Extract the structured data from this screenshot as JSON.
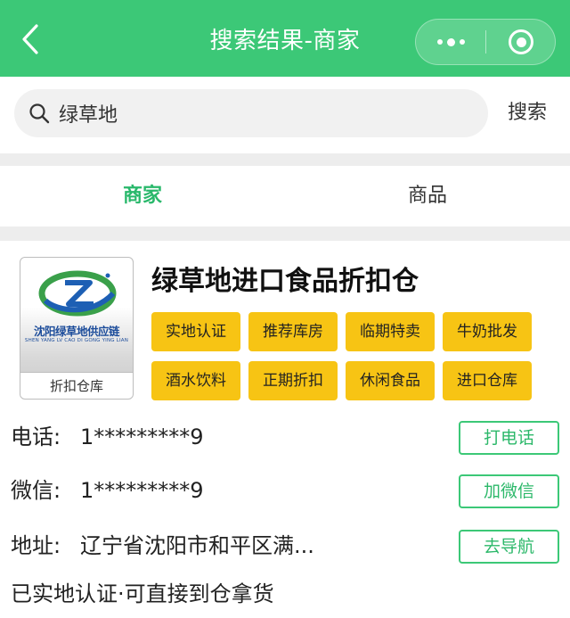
{
  "header": {
    "title": "搜索结果-商家",
    "back_icon": "chevron-left-icon",
    "more_icon": "more-dots-icon",
    "close_icon": "target-icon",
    "background_color": "#3cc877"
  },
  "search": {
    "value": "绿草地",
    "button_label": "搜索",
    "icon": "search-icon"
  },
  "tabs": [
    {
      "label": "商家",
      "active": true
    },
    {
      "label": "商品",
      "active": false
    }
  ],
  "merchant": {
    "logo": {
      "brand_cn": "沈阳绿草地供应链",
      "brand_en": "SHEN YANG LV CAO DI GONG YING LIAN",
      "caption": "折扣仓库"
    },
    "name": "绿草地进口食品折扣仓",
    "tags": [
      "实地认证",
      "推荐库房",
      "临期特卖",
      "牛奶批发",
      "酒水饮料",
      "正期折扣",
      "休闲食品",
      "进口仓库"
    ],
    "tag_color": "#f7c414",
    "phone": {
      "label": "电话:",
      "value": "1*********9",
      "button": "打电话"
    },
    "wechat": {
      "label": "微信:",
      "value": "1*********9",
      "button": "加微信"
    },
    "address": {
      "label": "地址:",
      "value": "辽宁省沈阳市和平区满...",
      "button": "去导航"
    },
    "note": "已实地认证·可直接到仓拿货"
  }
}
